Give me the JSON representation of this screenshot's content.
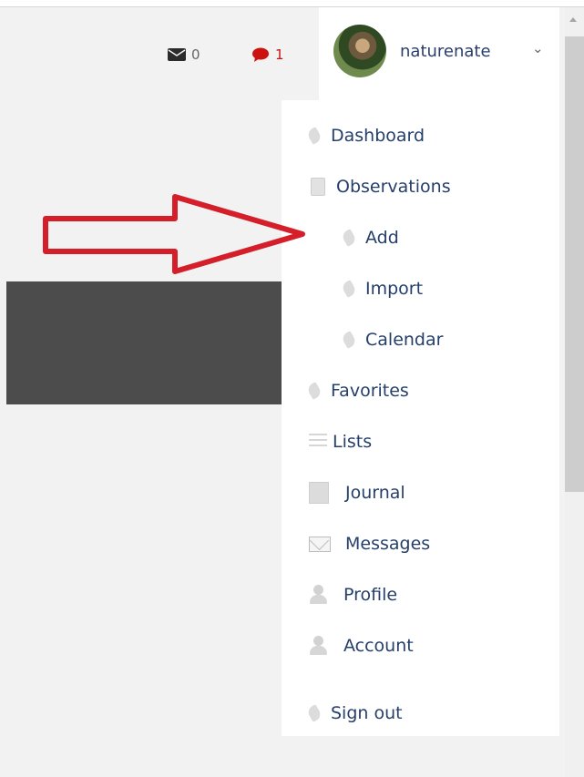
{
  "header": {
    "messages_count": "0",
    "notifications_count": "1",
    "username": "naturenate"
  },
  "menu": {
    "items": [
      {
        "label": "Dashboard"
      },
      {
        "label": "Observations"
      },
      {
        "label": "Add"
      },
      {
        "label": "Import"
      },
      {
        "label": "Calendar"
      },
      {
        "label": "Favorites"
      },
      {
        "label": "Lists"
      },
      {
        "label": "Journal"
      },
      {
        "label": "Messages"
      },
      {
        "label": "Profile"
      },
      {
        "label": "Account"
      },
      {
        "label": "Sign out"
      }
    ]
  },
  "colors": {
    "link": "#253f6b",
    "alert": "#cc1111",
    "annotation_arrow": "#d41f2a"
  },
  "icons": {
    "messages": "envelope-icon",
    "notifications": "speech-bubble-icon",
    "dropdown": "chevron-down-icon"
  }
}
